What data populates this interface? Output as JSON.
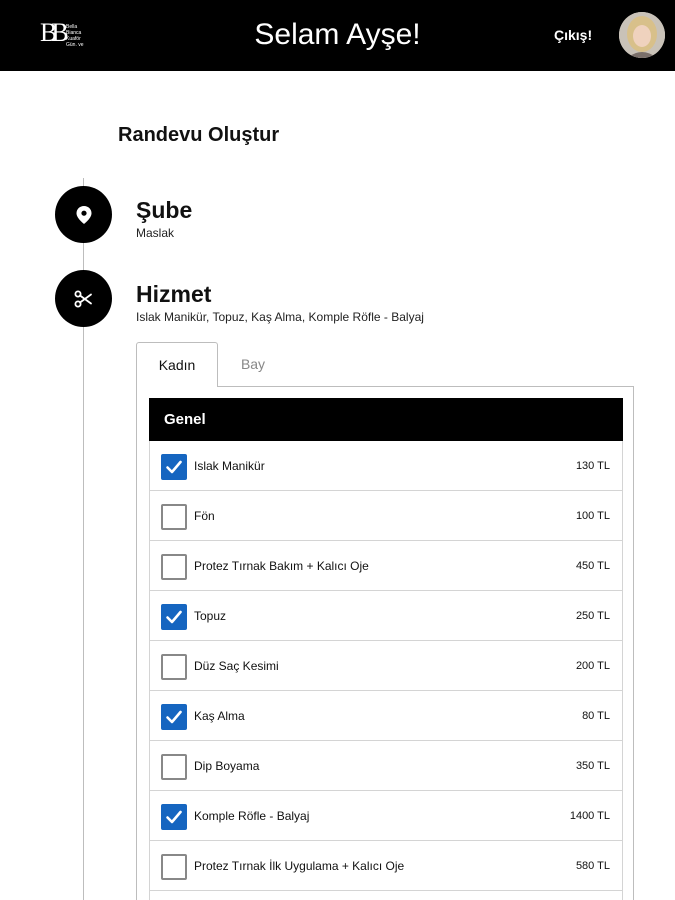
{
  "header": {
    "logo_mark": "BB",
    "logo_lines": [
      "Bella",
      "Bianca",
      "Kuaför",
      "Gün. ve"
    ],
    "title": "Selam Ayşe!",
    "logout_label": "Çıkış!"
  },
  "page": {
    "title": "Randevu Oluştur"
  },
  "steps": [
    {
      "icon": "map-pin-icon",
      "title": "Şube",
      "subtitle": "Maslak"
    },
    {
      "icon": "scissors-icon",
      "title": "Hizmet",
      "subtitle": "Islak Manikür, Topuz, Kaş Alma, Komple Röfle - Balyaj"
    }
  ],
  "tabs": [
    {
      "label": "Kadın",
      "active": true
    },
    {
      "label": "Bay",
      "active": false
    }
  ],
  "group": {
    "title": "Genel"
  },
  "services": [
    {
      "label": "Islak Manikür",
      "price": "130 TL",
      "checked": true
    },
    {
      "label": "Fön",
      "price": "100 TL",
      "checked": false
    },
    {
      "label": "Protez Tırnak Bakım + Kalıcı Oje",
      "price": "450 TL",
      "checked": false
    },
    {
      "label": "Topuz",
      "price": "250 TL",
      "checked": true
    },
    {
      "label": "Düz Saç Kesimi",
      "price": "200 TL",
      "checked": false
    },
    {
      "label": "Kaş Alma",
      "price": "80 TL",
      "checked": true
    },
    {
      "label": "Dip Boyama",
      "price": "350 TL",
      "checked": false
    },
    {
      "label": "Komple Röfle - Balyaj",
      "price": "1400 TL",
      "checked": true
    },
    {
      "label": "Protez Tırnak İlk Uygulama + Kalıcı Oje",
      "price": "580 TL",
      "checked": false
    },
    {
      "label": "",
      "price": "",
      "checked": false
    }
  ],
  "colors": {
    "header_bg": "#000000",
    "checkbox_checked": "#1565c0",
    "timeline_line": "#bdbdbd"
  }
}
